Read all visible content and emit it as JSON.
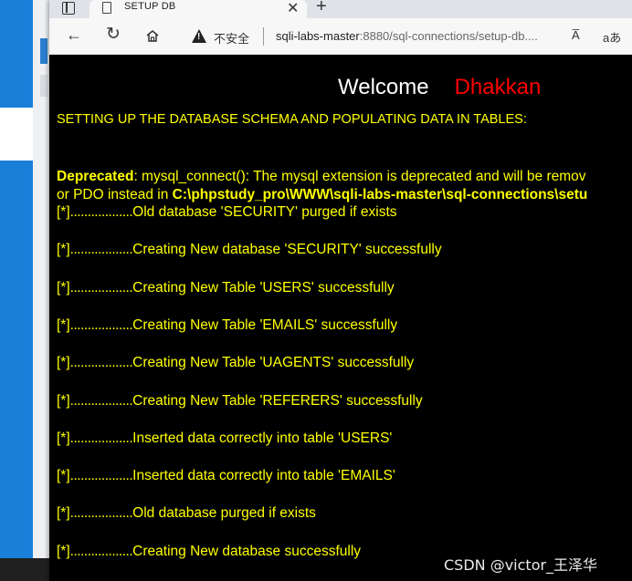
{
  "tab": {
    "title": "SETUP DB",
    "close": "✕",
    "new": "+"
  },
  "toolbar": {
    "back": "←",
    "reload": "↻",
    "insecure_label": "不安全",
    "url_host": "sqli-labs-master",
    "url_rest": ":8880/sql-connections/setup-db....",
    "read_aloud": "A̅",
    "immersive": "aあ"
  },
  "page": {
    "welcome": "Welcome",
    "name": "Dhakkan",
    "heading": "SETTING UP THE DATABASE SCHEMA AND POPULATING DATA IN TABLES:",
    "deprecated_label": "Deprecated",
    "deprecated_msg": ": mysql_connect(): The mysql extension is deprecated and will be remov",
    "deprecated_line2_prefix": "or PDO instead in ",
    "deprecated_path": "C:\\phpstudy_pro\\WWW\\sqli-labs-master\\sql-connections\\setu",
    "log_prefix": "[*]",
    "log_dots": "..................",
    "logs": [
      "Old database 'SECURITY' purged if exists",
      "Creating New database 'SECURITY' successfully",
      "Creating New Table 'USERS' successfully",
      "Creating New Table 'EMAILS' successfully",
      "Creating New Table 'UAGENTS' successfully",
      "Creating New Table 'REFERERS' successfully",
      "Inserted data correctly into table 'USERS'",
      "Inserted data correctly into table 'EMAILS'",
      "Old database purged if exists",
      "Creating New database successfully"
    ]
  },
  "watermark": "CSDN @victor_王泽华"
}
